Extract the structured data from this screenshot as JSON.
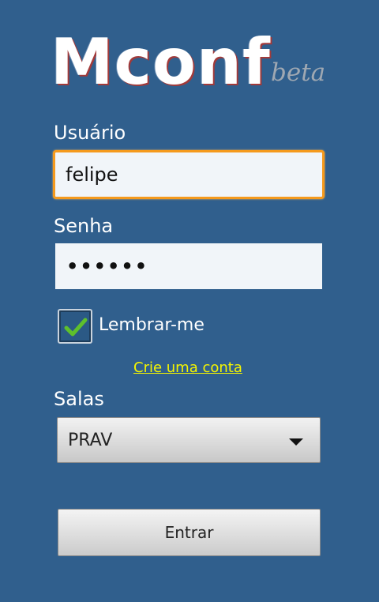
{
  "app": {
    "logo_text": "Mconf",
    "logo_tag": "beta"
  },
  "form": {
    "username_label": "Usuário",
    "username_value": "felipe",
    "password_label": "Senha",
    "password_mask": "••••••",
    "remember_label": "Lembrar-me",
    "remember_checked": true,
    "create_account_link": "Crie uma conta",
    "rooms_label": "Salas",
    "rooms_selected": "PRAV",
    "submit_label": "Entrar"
  },
  "colors": {
    "background": "#305f8d",
    "focus_border": "#f59a1d",
    "link": "#f5f500",
    "check": "#5ec02c"
  }
}
